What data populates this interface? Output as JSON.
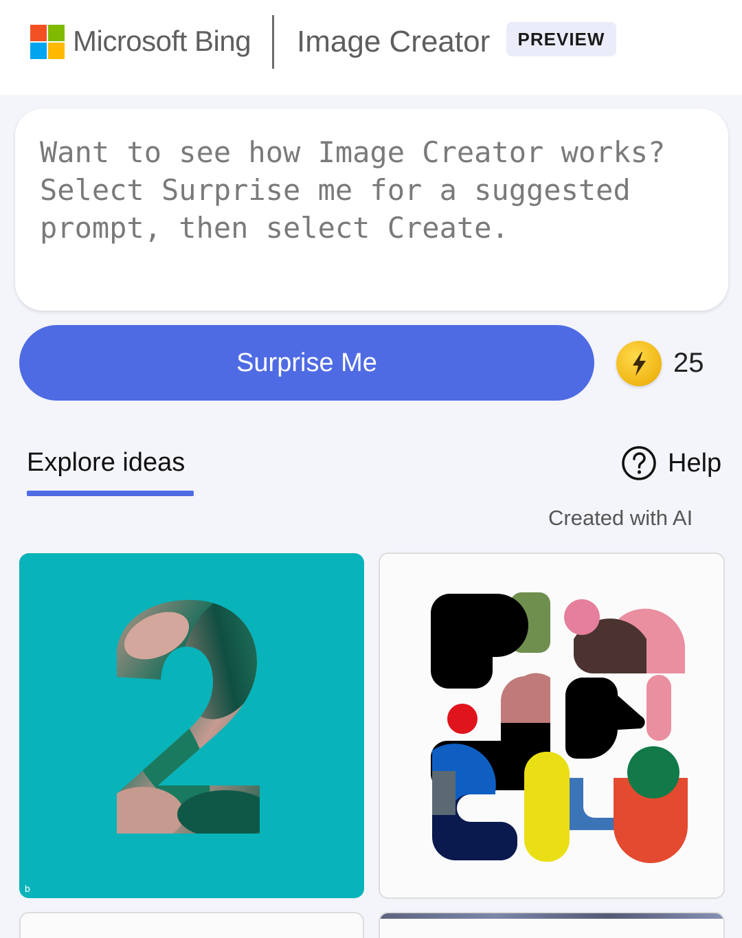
{
  "header": {
    "brand": "Microsoft Bing",
    "product": "Image Creator",
    "badge": "PREVIEW",
    "logo_colors": [
      "#f25022",
      "#7fba00",
      "#00a4ef",
      "#ffb900"
    ]
  },
  "prompt": {
    "placeholder": "Want to see how Image Creator works? Select Surprise me for a suggested prompt, then select Create."
  },
  "actions": {
    "surprise_label": "Surprise Me",
    "boost_icon": "lightning-coin-icon",
    "boost_count": "25"
  },
  "explore": {
    "tab_label": "Explore ideas",
    "help_label": "Help",
    "help_icon": "question-circle-icon",
    "created_note": "Created with AI"
  },
  "gallery": {
    "accent": "#4f6be3",
    "card1_bg": "#08b3ba",
    "card1_mark": "b"
  }
}
